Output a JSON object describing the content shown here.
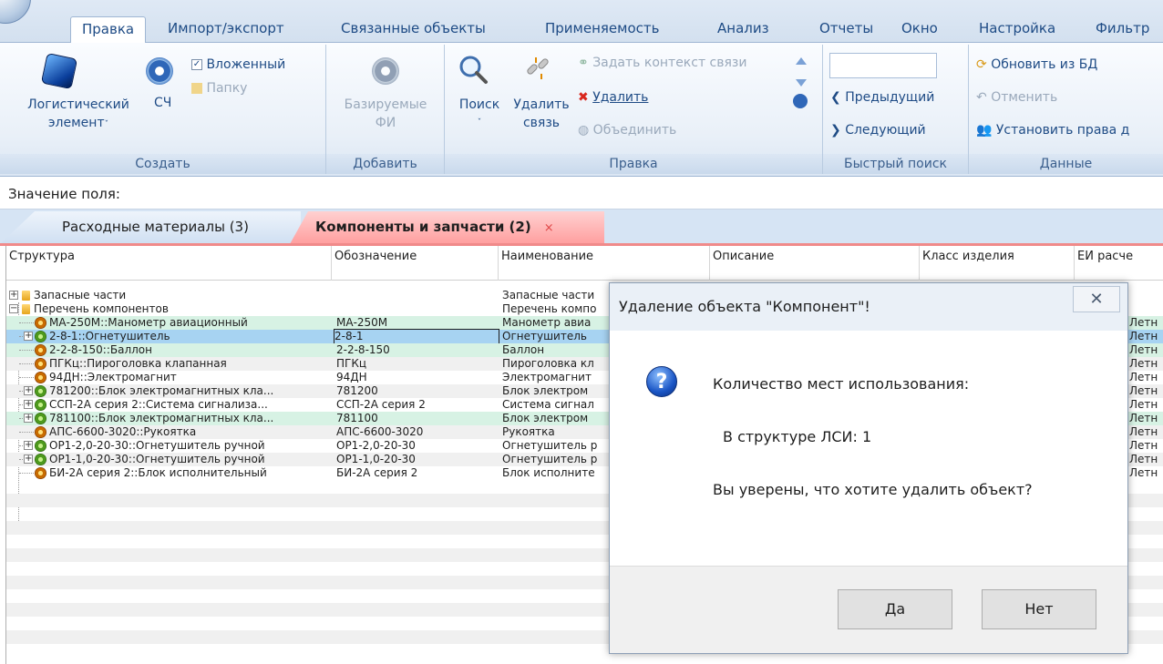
{
  "ribbon_tabs": [
    "Правка",
    "Импорт/экспорт",
    "Связанные объекты",
    "Применяемость",
    "Анализ",
    "Отчеты",
    "Окно",
    "Настройка",
    "Фильтр"
  ],
  "groups": {
    "create": {
      "title": "Создать",
      "logistic_line1": "Логистический",
      "logistic_line2": "элемент",
      "sch": "СЧ",
      "nested": "Вложенный",
      "folder": "Папку"
    },
    "add": {
      "title": "Добавить",
      "line1": "Базируемые",
      "line2": "ФИ"
    },
    "edit": {
      "title": "Правка",
      "search": "Поиск",
      "remove_link_line1": "Удалить",
      "remove_link_line2": "связь",
      "set_context": "Задать контекст связи",
      "delete": "Удалить",
      "merge": "Объединить"
    },
    "quick_search": {
      "title": "Быстрый поиск",
      "prev": "Предыдущий",
      "next": "Следующий",
      "value": ""
    },
    "data": {
      "title": "Данные",
      "refresh": "Обновить из БД",
      "cancel": "Отменить",
      "rights": "Установить права д"
    }
  },
  "field_label": "Значение поля:",
  "doc_tabs": [
    {
      "label": "Расходные материалы (3)"
    },
    {
      "label": "Компоненты и запчасти (2)",
      "close": "×"
    }
  ],
  "columns": [
    "Структура",
    "Обозначение",
    "Наименование",
    "Описание",
    "Класс изделия",
    "ЕИ расче"
  ],
  "rows": [
    {
      "structure": "Запасные части",
      "designation": "",
      "name": "Запасные части"
    },
    {
      "structure": "Перечень компонентов",
      "designation": "",
      "name": "Перечень компо"
    },
    {
      "structure": "МА-250М::Манометр авиационный",
      "designation": "МА-250М",
      "name": "Манометр авиа",
      "unit": "Летн"
    },
    {
      "structure": "2-8-1::Огнетушитель",
      "designation": "2-8-1",
      "name": "Огнетушитель",
      "unit": "Летн"
    },
    {
      "structure": "2-2-8-150::Баллон",
      "designation": "2-2-8-150",
      "name": "Баллон",
      "unit": "Летн"
    },
    {
      "structure": "ПГКц::Пироголовка клапанная",
      "designation": "ПГКц",
      "name": "Пироголовка кл",
      "unit": "Летн"
    },
    {
      "structure": "94ДН::Электромагнит",
      "designation": "94ДН",
      "name": "Электромагнит",
      "unit": "Летн"
    },
    {
      "structure": "781200::Блок электромагнитных кла...",
      "designation": "781200",
      "name": "Блок электром",
      "unit": "Летн"
    },
    {
      "structure": "ССП-2А серия 2::Система сигнализа...",
      "designation": "ССП-2А серия 2",
      "name": "Система сигнал",
      "unit": "Летн"
    },
    {
      "structure": "781100::Блок электромагнитных кла...",
      "designation": "781100",
      "name": "Блок электром",
      "unit": "Летн"
    },
    {
      "structure": "АПС-6600-3020::Рукоятка",
      "designation": "АПС-6600-3020",
      "name": "Рукоятка",
      "unit": "Летн"
    },
    {
      "structure": "ОР1-2,0-20-30::Огнетушитель ручной",
      "designation": "ОР1-2,0-20-30",
      "name": "Огнетушитель р",
      "unit": "Летн"
    },
    {
      "structure": "ОР1-1,0-20-30::Огнетушитель ручной",
      "designation": "ОР1-1,0-20-30",
      "name": "Огнетушитель р",
      "unit": "Летн"
    },
    {
      "structure": "БИ-2А серия 2::Блок исполнительный",
      "designation": "БИ-2А серия 2",
      "name": "Блок исполните",
      "unit": "Летн"
    }
  ],
  "dialog": {
    "title": "Удаление объекта \"Компонент\"!",
    "close": "✕",
    "line1": "Количество мест использования:",
    "line2": "В структуре ЛСИ: 1",
    "line3": "Вы уверены, что хотите удалить объект?",
    "yes": "Да",
    "no": "Нет"
  }
}
